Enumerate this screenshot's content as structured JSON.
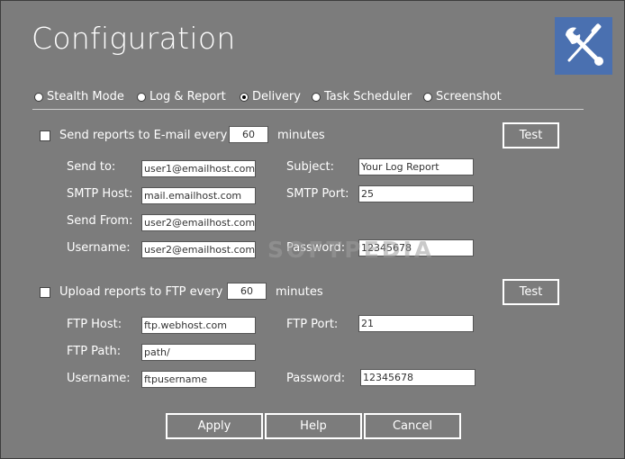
{
  "window": {
    "title": "Configuration",
    "icon": "tools-icon"
  },
  "tabs": [
    {
      "label": "Stealth Mode",
      "selected": false
    },
    {
      "label": "Log & Report",
      "selected": false
    },
    {
      "label": "Delivery",
      "selected": true
    },
    {
      "label": "Task Scheduler",
      "selected": false
    },
    {
      "label": "Screenshot",
      "selected": false
    }
  ],
  "email": {
    "checkbox_label": "Send reports to E-mail every",
    "checked": false,
    "interval": "60",
    "unit": "minutes",
    "test_label": "Test",
    "send_to_label": "Send to:",
    "send_to": "user1@emailhost.com",
    "subject_label": "Subject:",
    "subject": "Your Log Report",
    "smtp_host_label": "SMTP Host:",
    "smtp_host": "mail.emailhost.com",
    "smtp_port_label": "SMTP Port:",
    "smtp_port": "25",
    "send_from_label": "Send From:",
    "send_from": "user2@emailhost.com",
    "username_label": "Username:",
    "username": "user2@emailhost.com",
    "password_label": "Password:",
    "password": "12345678"
  },
  "ftp": {
    "checkbox_label": "Upload reports to FTP every",
    "checked": false,
    "interval": "60",
    "unit": "minutes",
    "test_label": "Test",
    "host_label": "FTP Host:",
    "host": "ftp.webhost.com",
    "port_label": "FTP Port:",
    "port": "21",
    "path_label": "FTP Path:",
    "path": "path/",
    "username_label": "Username:",
    "username": "ftpusername",
    "password_label": "Password:",
    "password": "12345678"
  },
  "footer": {
    "apply_label": "Apply",
    "help_label": "Help",
    "cancel_label": "Cancel"
  },
  "watermark": "SOFTPEDIA",
  "colors": {
    "background": "#7c7c7c",
    "icon_tile": "#4a70b0",
    "text": "#ffffff"
  }
}
